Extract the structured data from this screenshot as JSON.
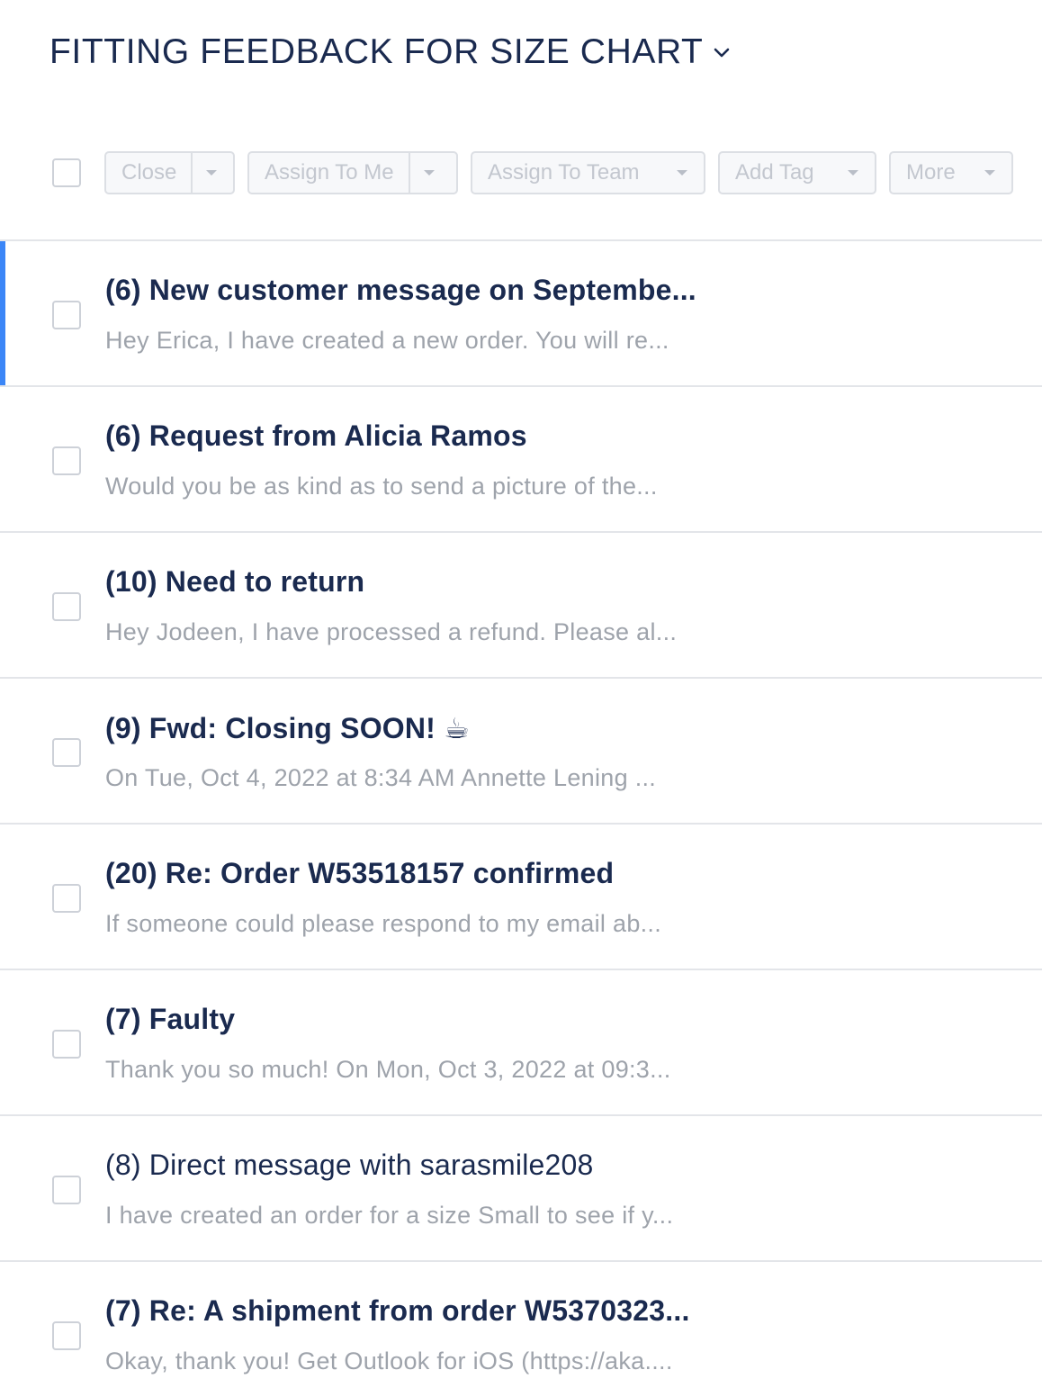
{
  "header": {
    "title": "FITTING FEEDBACK FOR SIZE CHART"
  },
  "toolbar": {
    "close_label": "Close",
    "assign_me_label": "Assign To Me",
    "assign_team_label": "Assign To Team",
    "add_tag_label": "Add Tag",
    "more_label": "More"
  },
  "colors": {
    "accent": "#3b86f7",
    "title": "#1a2a4f",
    "preview": "#9ea3ab",
    "disabled": "#c3c7cf"
  },
  "conversations": [
    {
      "subject": "(6) New customer message on Septembe...",
      "preview": "Hey Erica, I have created a new order. You will re...",
      "active": true,
      "unread": true
    },
    {
      "subject": "(6) Request from Alicia Ramos",
      "preview": "Would you be as kind as to send a picture of the...",
      "active": false,
      "unread": true
    },
    {
      "subject": "(10) Need to return",
      "preview": "Hey Jodeen, I have processed a refund. Please al...",
      "active": false,
      "unread": true
    },
    {
      "subject": "(9) Fwd: Closing SOON! ☕",
      "preview": "On Tue, Oct 4, 2022 at 8:34 AM Annette Lening ...",
      "active": false,
      "unread": true
    },
    {
      "subject": "(20) Re: Order W53518157 confirmed",
      "preview": "If someone could please respond to my email ab...",
      "active": false,
      "unread": true
    },
    {
      "subject": "(7) Faulty",
      "preview": "Thank you so much! On Mon, Oct 3, 2022 at 09:3...",
      "active": false,
      "unread": true
    },
    {
      "subject": "(8) Direct message with sarasmile208",
      "preview": "I have created an order for a size Small to see if y...",
      "active": false,
      "unread": false
    },
    {
      "subject": "(7) Re: A shipment from order W5370323...",
      "preview": "Okay, thank you! Get Outlook for iOS (https://aka....",
      "active": false,
      "unread": true
    }
  ]
}
